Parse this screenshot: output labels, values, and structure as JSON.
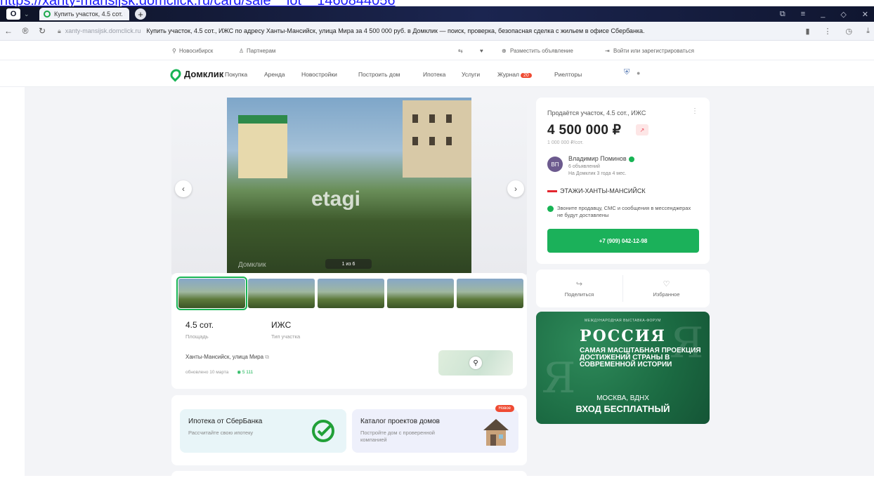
{
  "top_link": "https://xanty-mansijsk.domclick.ru/card/sale__lot__1460844056",
  "browser": {
    "tab_title": "Купить участок, 4.5 сот. ×",
    "new_tab": "+",
    "url_domain": "xanty-mansijsk.domclick.ru",
    "page_title": "Купить участок, 4.5 сот., ИЖС по адресу Ханты-Мансийск, улица Мира за 4 500 000 руб. в Домклик — поиск, проверка, безопасная сделка с жильем в офисе Сбербанка."
  },
  "util_bar": {
    "city": "Новосибирск",
    "partners": "Партнерам",
    "place_ad": "Разместить объявление",
    "login": "Войти или зарегистрироваться"
  },
  "nav": {
    "logo": "Домклик",
    "items": [
      "Покупка",
      "Аренда",
      "Новостройки",
      "Построить дом",
      "Ипотека",
      "Услуги",
      "Журнал",
      "Риелторы"
    ],
    "journal_badge": "20"
  },
  "gallery": {
    "watermark": "etagi",
    "watermark2": "Домклик",
    "counter": "1 из 6"
  },
  "facts": {
    "area_value": "4.5 сот.",
    "area_label": "Площадь",
    "type_value": "ИЖС",
    "type_label": "Тип участка"
  },
  "address": "Ханты-Мансийск, улица Мира",
  "updated": "обновлено 10 марта",
  "views": "5 111",
  "promos": {
    "sber_title": "Ипотека от СберБанка",
    "sber_sub": "Рассчитайте свою ипотеку",
    "catalog_title": "Каталог проектов домов",
    "catalog_sub": "Постройте дом с проверенной компанией",
    "new_badge": "Новое"
  },
  "offer": {
    "title": "Продаётся участок, 4.5 сот., ИЖС",
    "price": "4 500 000 ₽",
    "per_unit": "1 000 000 ₽/сот.",
    "seller_initials": "ВП",
    "seller_name": "Владимир Поминов",
    "seller_ads": "6 объявлений",
    "seller_since": "На Домклик 3 года 4 мес.",
    "agency": "ЭТАЖИ-ХАНТЫ-МАНСИЙСК",
    "warning": "Звоните продавцу, СМС и сообщения в мессенджерах не будут доставлены",
    "phone": "+7 (909) 042-12-98",
    "share": "Поделиться",
    "favorite": "Избранное"
  },
  "ad": {
    "small": "МЕЖДУНАРОДНАЯ ВЫСТАВКА-ФОРУМ",
    "title": "РОССИЯ",
    "claim": "САМАЯ МАСШТАБНАЯ ПРОЕКЦИЯ ДОСТИЖЕНИЙ СТРАНЫ В СОВРЕМЕННОЙ ИСТОРИИ",
    "city": "МОСКВА, ВДНХ",
    "free": "ВХОД БЕСПЛАТНЫЙ"
  }
}
